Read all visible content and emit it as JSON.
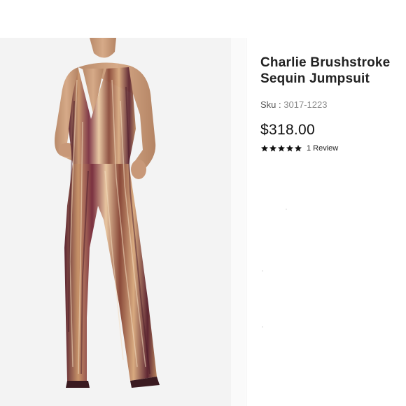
{
  "product": {
    "title": "Charlie Brushstroke Sequin Jumpsuit",
    "sku_label": "Sku :",
    "sku_value": "3017-1223",
    "price": "$318.00",
    "rating": 5,
    "rating_max": 5,
    "review_label": "1 Review"
  },
  "image": {
    "subject": "model wearing sequin jumpsuit"
  },
  "colors": {
    "background": "#ffffff",
    "photo_background": "#f3f3f3",
    "text": "#222222",
    "muted": "#8a8a8a",
    "sequin_gold": "#c89a6e",
    "sequin_plum": "#6a2a3a"
  },
  "icons": {
    "star": "star-icon"
  }
}
